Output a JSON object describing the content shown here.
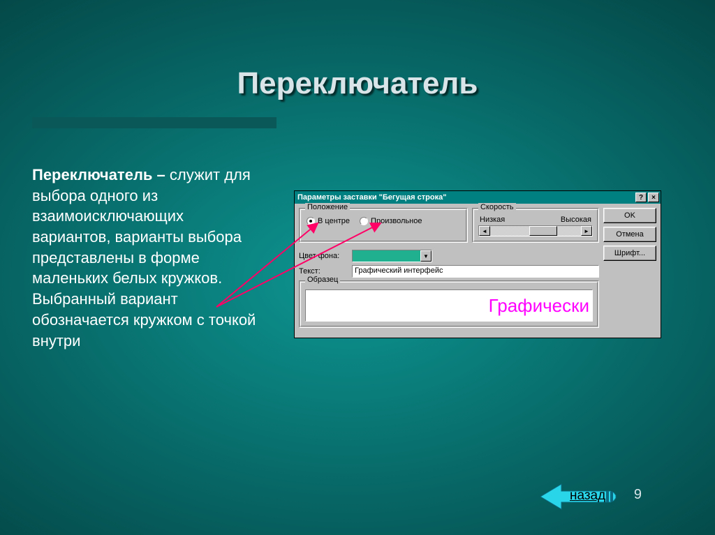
{
  "slide": {
    "title": "Переключатель",
    "body_bold": "Переключатель –",
    "body_rest": " служит для выбора одного из взаимоисключающих вариантов, варианты выбора представлены в форме маленьких белых кружков. Выбранный вариант обозначается кружком с точкой внутри",
    "page_number": "9",
    "back_label": "назад"
  },
  "dialog": {
    "title": "Параметры заставки \"Бегущая строка\"",
    "help_btn": "?",
    "close_btn": "×",
    "group_position": "Положение",
    "radio_center": "В центре",
    "radio_arbitrary": "Произвольное",
    "group_speed": "Скорость",
    "speed_low": "Низкая",
    "speed_high": "Высокая",
    "bg_color_label": "Цвет фона:",
    "bg_color_value": "#20b090",
    "text_label": "Текст:",
    "text_value": "Графический интерфейс",
    "group_sample": "Образец",
    "sample_text": "Графически",
    "btn_ok": "OK",
    "btn_cancel": "Отмена",
    "btn_font": "Шрифт..."
  }
}
